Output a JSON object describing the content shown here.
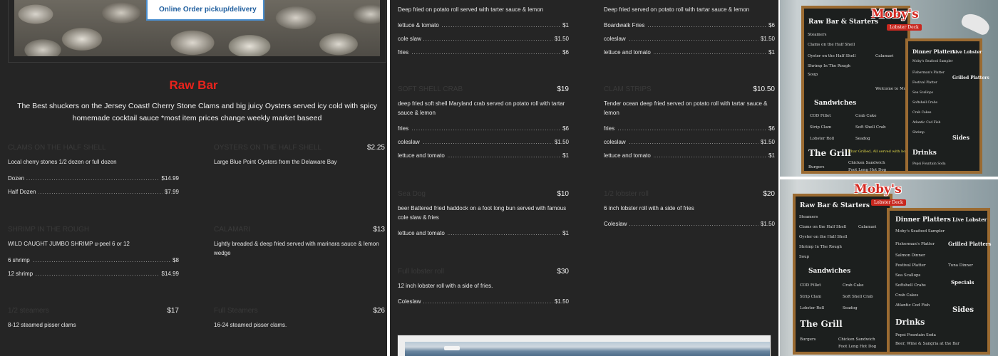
{
  "banner": {
    "order_link": "Online Order pickup/delivery"
  },
  "raw_bar": {
    "title": "Raw Bar",
    "description": "The Best shuckers on the Jersey Coast! Cherry Stone Clams and big juicy Oysters served icy cold with spicy homemade cocktail sauce *most item prices change weekly market baseed",
    "items": [
      {
        "name": "CLAMS ON THE HALF SHELL",
        "price": "",
        "desc": "Local cherry stones 1/2 dozen or full dozen",
        "options": [
          {
            "label": "Dozen",
            "price": "$14.99"
          },
          {
            "label": "Half Dozen",
            "price": "$7.99"
          }
        ]
      },
      {
        "name": "OYSTERS ON THE HALF SHELL",
        "price": "$2.25",
        "desc": "Large Blue Point Oysters from the Delaware Bay",
        "options": []
      },
      {
        "name": "SHRIMP IN THE ROUGH",
        "price": "",
        "desc": "WILD CAUGHT JUMBO SHRIMP u-peel 6 or 12",
        "options": [
          {
            "label": "6 shrimp",
            "price": "$8"
          },
          {
            "label": "12 shrimp",
            "price": "$14.99"
          }
        ]
      },
      {
        "name": "CALAMARI",
        "price": "$13",
        "desc": "Lightly breaded & deep fried served with marinara sauce & lemon wedge",
        "options": []
      },
      {
        "name": "1/2 steamers",
        "price": "$17",
        "desc": "8-12 steamed pisser clams",
        "options": []
      },
      {
        "name": "Full Steamers",
        "price": "$26",
        "desc": "16-24 steamed pisser clams.",
        "options": []
      }
    ]
  },
  "sandwiches_left": [
    {
      "name": "",
      "price": "",
      "desc": "Deep fried on potato roll served with tarter sauce & lemon",
      "options": [
        {
          "label": "lettuce & tomato",
          "price": "$1"
        },
        {
          "label": "cole slaw",
          "price": "$1.50"
        },
        {
          "label": "fries",
          "price": "$6"
        }
      ]
    },
    {
      "name": "SOFT SHELL CRAB",
      "price": "$19",
      "desc": "deep fried soft shell Maryland crab served on potato roll with tartar sauce & lemon",
      "options": [
        {
          "label": "fries",
          "price": "$6"
        },
        {
          "label": "coleslaw",
          "price": "$1.50"
        },
        {
          "label": "lettuce and tomato",
          "price": "$1"
        }
      ]
    },
    {
      "name": "Sea Dog",
      "price": "$10",
      "desc": "beer Battered fried haddock on a foot long bun served with famous cole slaw & fries",
      "options": [
        {
          "label": "lettuce and tomato",
          "price": "$1"
        }
      ]
    },
    {
      "name": "Full lobster roll",
      "price": "$30",
      "desc": "12 inch lobster roll with a side of fries.",
      "options": [
        {
          "label": "Coleslaw",
          "price": "$1.50"
        }
      ]
    }
  ],
  "sandwiches_right": [
    {
      "name": "",
      "price": "",
      "desc": "Deep fried served on potato roll with tartar sauce & lemon",
      "options": [
        {
          "label": "Boardwalk Fries",
          "price": "$6"
        },
        {
          "label": "coleslaw",
          "price": "$1.50"
        },
        {
          "label": "lettuce and tomato",
          "price": "$1"
        }
      ]
    },
    {
      "name": "CLAM STRIPS",
      "price": "$10.50",
      "desc": "Tender ocean deep fried served on potato roll with tartar sauce & lemon",
      "options": [
        {
          "label": "fries",
          "price": "$6"
        },
        {
          "label": "coleslaw",
          "price": "$1.50"
        },
        {
          "label": "lettuce and tomato",
          "price": "$1"
        }
      ]
    },
    {
      "name": "1/2 lobster roll",
      "price": "$20",
      "desc": "6 inch lobster roll with a side of fries",
      "options": [
        {
          "label": "Coleslaw",
          "price": "$1.50"
        }
      ]
    }
  ],
  "sign": {
    "logo": "Moby's",
    "logo_sub": "Lobster Deck",
    "raw_bar": "Raw Bar & Starters",
    "sandwiches": "Sandwiches",
    "grill": "The Grill",
    "dinner": "Dinner Platters",
    "live_lobster": "Live Lobster",
    "grilled": "Grilled Platters",
    "sides": "Sides",
    "drinks": "Drinks",
    "steamers": "Steamers",
    "clams": "Clams on the Half Shell",
    "oysters": "Oyster on the Half Shell",
    "shrimp": "Shrimp In The Rough",
    "soup": "Soup",
    "calamari": "Calamari",
    "cod": "COD Fillet",
    "crab_cake": "Crab Cake",
    "strip_clam": "Strip Clam",
    "soft_shell": "Soft Shell Crab",
    "lobster_roll": "Lobster Roll",
    "seadog": "Seadog",
    "burgers": "Burgers",
    "chicken": "Chicken Sandwich",
    "hotdog": "Foot Long Hot Dog",
    "samplers": "Moby's Seafood Sampler",
    "fisherman": "Fisherman's Platter",
    "festival": "Festival Platter",
    "scallops": "Sea Scallops",
    "softshell": "Softshell Crabs",
    "crab_cakes": "Crab Cakes",
    "atlantic": "Atlantic Cod Fish",
    "shrimp2": "Shrimp",
    "salmon": "Salmon Dinner",
    "tuna": "Tuna Dinner",
    "specials": "Specials",
    "pepsi": "Pepsi Fountain Soda",
    "beer": "Beer, Wine & Sangria at the Bar",
    "welcome": "Welcome to Moby's",
    "char": "Char Grilled, All served with boardwalk fries"
  }
}
